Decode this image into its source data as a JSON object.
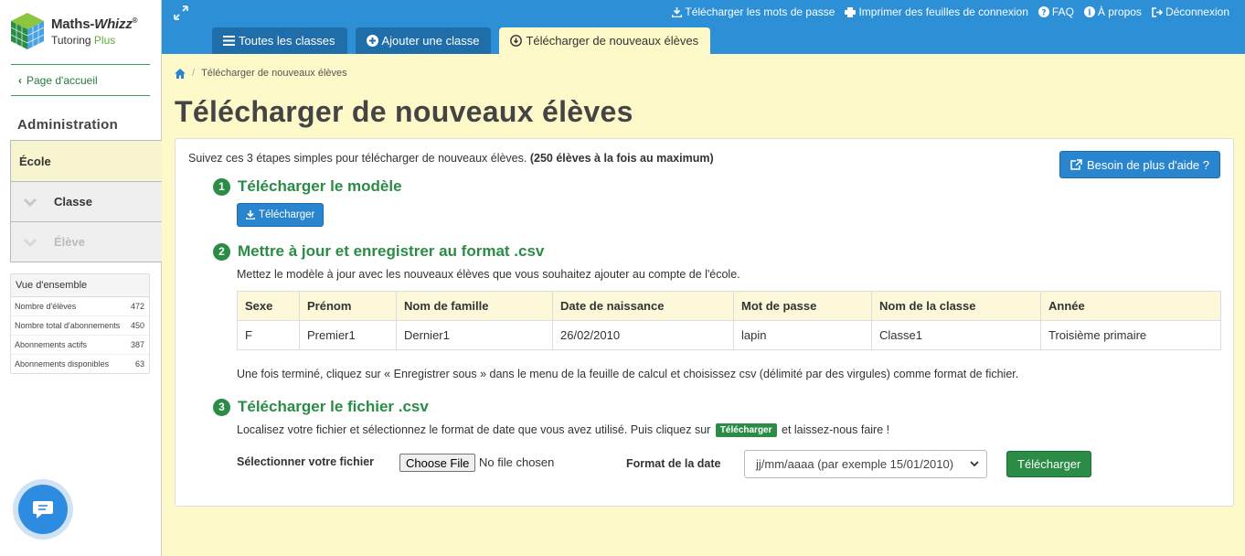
{
  "logo": {
    "title_a": "Maths-",
    "title_b": "Whizz",
    "reg": "®",
    "sub_a": "Tutoring ",
    "sub_b": "Plus"
  },
  "sidebar": {
    "home_link": "Page d'accueil",
    "admin_title": "Administration",
    "nav": [
      {
        "label": "École"
      },
      {
        "label": "Classe"
      },
      {
        "label": "Élève"
      }
    ],
    "overview": {
      "title": "Vue d'ensemble",
      "rows": [
        {
          "label": "Nombre d'élèves",
          "value": "472"
        },
        {
          "label": "Nombre total d'abonnements",
          "value": "450"
        },
        {
          "label": "Abonnements actifs",
          "value": "387"
        },
        {
          "label": "Abonnements disponibles",
          "value": "63"
        }
      ]
    }
  },
  "topbar": {
    "links": [
      {
        "label": "Télécharger les mots de passe",
        "icon": "download-icon"
      },
      {
        "label": "Imprimer des feuilles de connexion",
        "icon": "print-icon"
      },
      {
        "label": "FAQ",
        "icon": "question-icon"
      },
      {
        "label": "À propos",
        "icon": "info-icon"
      },
      {
        "label": "Déconnexion",
        "icon": "logout-icon"
      }
    ],
    "tabs": [
      {
        "label": "Toutes les classes",
        "icon": "list-icon"
      },
      {
        "label": "Ajouter une classe",
        "icon": "plus-circle-icon"
      },
      {
        "label": "Télécharger de nouveaux élèves",
        "icon": "upload-circle-icon"
      }
    ]
  },
  "breadcrumb": {
    "current": "Télécharger de nouveaux élèves"
  },
  "page_title": "Télécharger de nouveaux élèves",
  "panel": {
    "intro": "Suivez ces 3 étapes simples pour télécharger de nouveaux élèves.",
    "intro_bold": "(250 élèves à la fois au maximum)",
    "help_button": "Besoin de plus d'aide ?",
    "steps": [
      {
        "num": "1",
        "title": "Télécharger le modèle"
      },
      {
        "num": "2",
        "title": "Mettre à jour et enregistrer au format .csv"
      },
      {
        "num": "3",
        "title": "Télécharger le fichier .csv"
      }
    ],
    "download_button": "Télécharger",
    "step2_text": "Mettez le modèle à jour avec les nouveaux élèves que vous souhaitez ajouter au compte de l'école.",
    "table": {
      "headers": [
        "Sexe",
        "Prénom",
        "Nom de famille",
        "Date de naissance",
        "Mot de passe",
        "Nom de la classe",
        "Année"
      ],
      "rows": [
        [
          "F",
          "Premier1",
          "Dernier1",
          "26/02/2010",
          "lapin",
          "Classe1",
          "Troisième primaire"
        ]
      ]
    },
    "after_table_text": "Une fois terminé, cliquez sur « Enregistrer sous » dans le menu de la feuille de calcul et choisissez csv (délimité par des virgules) comme format de fichier.",
    "step3_text_a": "Localisez votre fichier et sélectionnez le format de date que vous avez utilisé. Puis cliquez sur",
    "step3_badge": "Télécharger",
    "step3_text_b": "et laissez-nous faire !",
    "file_label": "Sélectionner votre fichier",
    "file_button": "Choose File",
    "file_status": "No file chosen",
    "date_label": "Format de la date",
    "date_value": "jj/mm/aaaa (par exemple 15/01/2010)",
    "upload_button": "Télécharger"
  },
  "colors": {
    "topbar": "#2d8fd6",
    "tab_dark": "#1f6eaa",
    "background": "#fdf9c9",
    "green": "#2a8c45",
    "blue_button": "#2a85cf"
  }
}
